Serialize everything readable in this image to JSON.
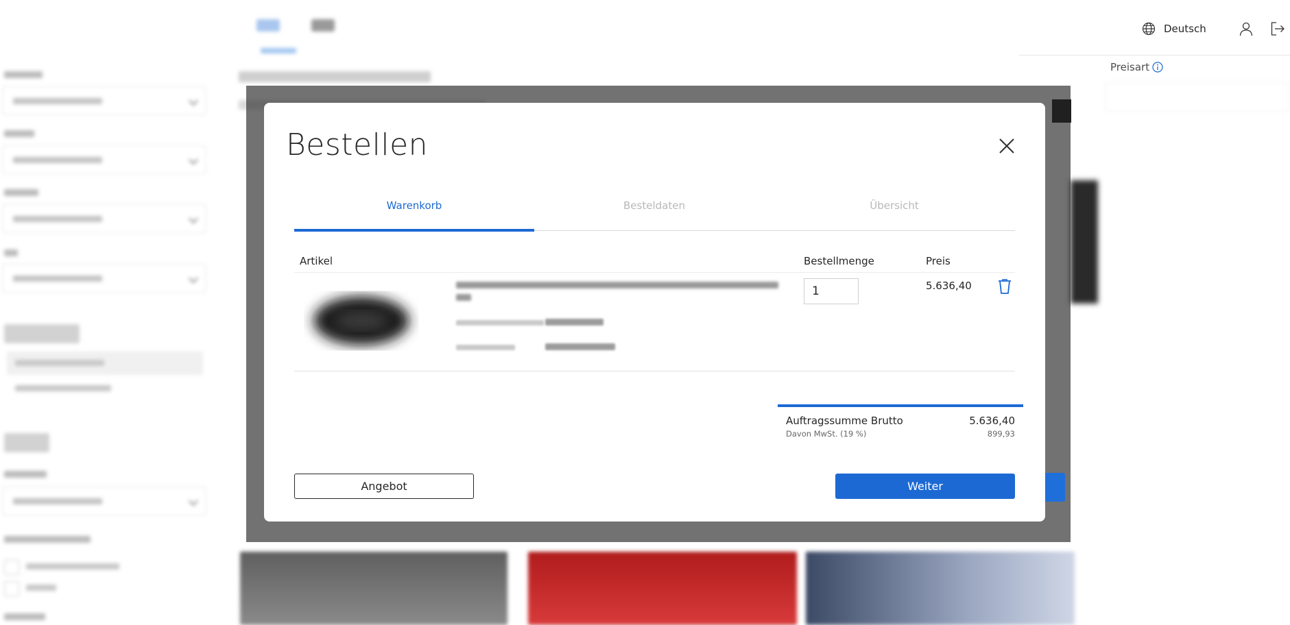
{
  "header": {
    "language_label": "Deutsch",
    "price_type_label": "Preisart"
  },
  "modal": {
    "title": "Bestellen",
    "steps": [
      {
        "label": "Warenkorb",
        "state": "active"
      },
      {
        "label": "Besteldaten",
        "state": "inactive"
      },
      {
        "label": "Übersicht",
        "state": "inactive"
      }
    ],
    "table": {
      "columns": {
        "article": "Artikel",
        "quantity": "Bestellmenge",
        "price": "Preis"
      },
      "row": {
        "quantity": "1",
        "price": "5.636,40"
      }
    },
    "summary": {
      "total_label": "Auftragssumme Brutto",
      "total_value": "5.636,40",
      "vat_label": "Davon MwSt. (19 %)",
      "vat_value": "899,93"
    },
    "buttons": {
      "offer": "Angebot",
      "next": "Weiter"
    }
  },
  "colors": {
    "accent": "#1c69d4",
    "overlay": "#3c3c3c",
    "text": "#262626"
  },
  "icons": [
    "globe-icon",
    "user-icon",
    "logout-icon",
    "info-icon",
    "close-icon",
    "trash-icon"
  ]
}
